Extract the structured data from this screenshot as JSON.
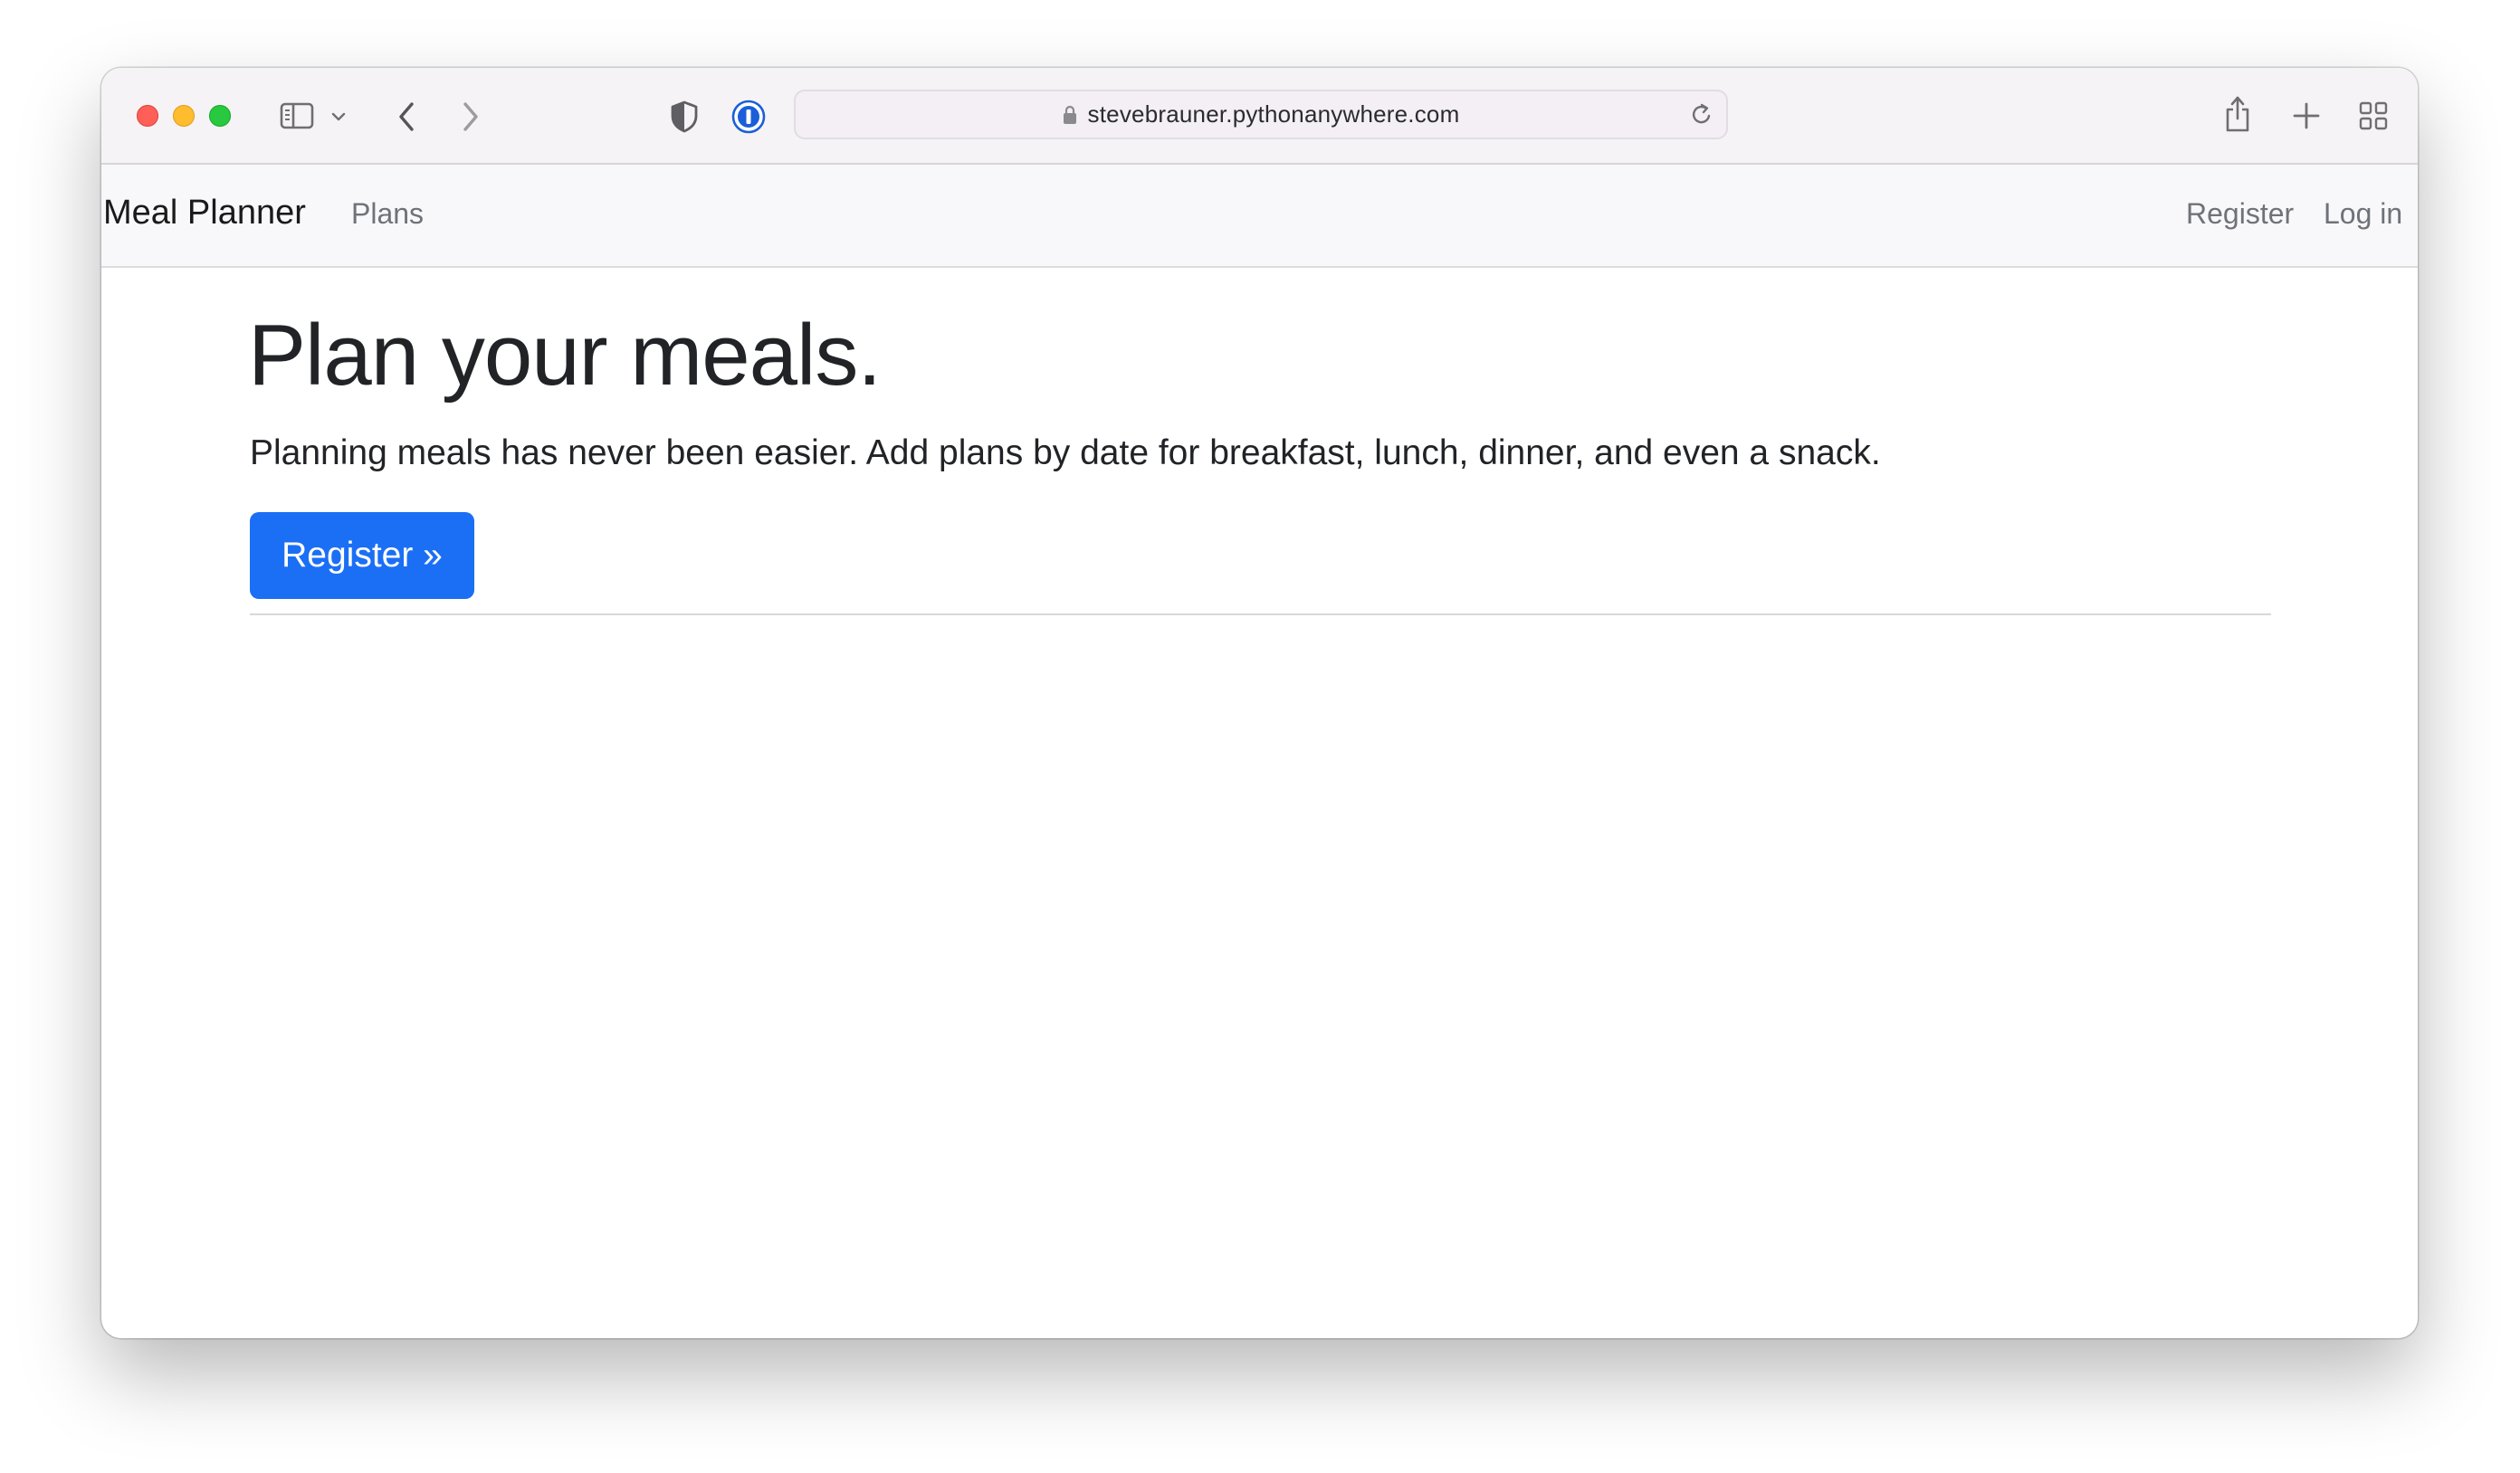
{
  "browser": {
    "url": "stevebrauner.pythonanywhere.com"
  },
  "navbar": {
    "brand": "Meal Planner",
    "links": {
      "plans": "Plans",
      "register": "Register",
      "login": "Log in"
    }
  },
  "hero": {
    "title": "Plan your meals.",
    "lead": "Planning meals has never been easier. Add plans by date for breakfast, lunch, dinner, and even a snack.",
    "button_label": "Register »"
  },
  "colors": {
    "primary": "#1b6ff5",
    "navbar_bg": "#f8f8fa",
    "toolbar_bg": "#f6f3f7",
    "traffic_close": "#ff5f57",
    "traffic_minimize": "#febc2e",
    "traffic_maximize": "#28c840"
  },
  "icons": {
    "toolbar": [
      "sidebar-icon",
      "chevron-down-icon",
      "back-arrow-icon",
      "forward-arrow-icon",
      "shield-icon",
      "password-manager-icon",
      "lock-icon",
      "reload-icon",
      "share-icon",
      "new-tab-icon",
      "tab-overview-icon"
    ]
  }
}
